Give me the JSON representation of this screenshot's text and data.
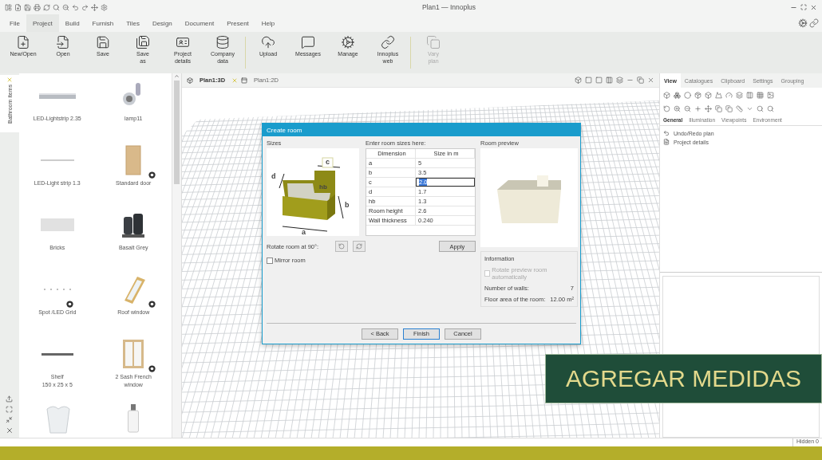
{
  "window": {
    "title": "Plan1 — Innoplus"
  },
  "menu": [
    {
      "label": "File",
      "selected": false
    },
    {
      "label": "Project",
      "selected": true
    },
    {
      "label": "Build",
      "selected": false
    },
    {
      "label": "Furnish",
      "selected": false
    },
    {
      "label": "Tiles",
      "selected": false
    },
    {
      "label": "Design",
      "selected": false
    },
    {
      "label": "Document",
      "selected": false
    },
    {
      "label": "Present",
      "selected": false
    },
    {
      "label": "Help",
      "selected": false
    }
  ],
  "ribbon": [
    {
      "buttons": [
        {
          "kind": "newopen",
          "label": "New/Open",
          "disabled": false
        },
        {
          "kind": "open",
          "label": "Open",
          "disabled": false
        },
        {
          "kind": "save",
          "label": "Save",
          "disabled": false
        },
        {
          "kind": "saveas",
          "label": "Save\nas",
          "disabled": false
        },
        {
          "kind": "details",
          "label": "Project\ndetails",
          "disabled": false
        },
        {
          "kind": "company",
          "label": "Company\ndata",
          "disabled": false
        }
      ]
    },
    {
      "buttons": [
        {
          "kind": "upload",
          "label": "Upload",
          "disabled": false
        },
        {
          "kind": "messages",
          "label": "Messages",
          "disabled": false
        },
        {
          "kind": "manage",
          "label": "Manage",
          "disabled": false
        },
        {
          "kind": "web",
          "label": "Innoplus\nweb",
          "disabled": false
        }
      ]
    },
    {
      "buttons": [
        {
          "kind": "vary",
          "label": "Vary\nplan",
          "disabled": true
        }
      ]
    }
  ],
  "catalog": {
    "tab": "Bathroom items",
    "items": [
      {
        "kind": "strip",
        "label": "LED-Lightstrip 2.35",
        "configurable": false
      },
      {
        "kind": "lamp",
        "label": "lamp11",
        "configurable": false
      },
      {
        "kind": "line",
        "label": "LED-Light strip 1.3",
        "configurable": false
      },
      {
        "kind": "door",
        "label": "Standard door",
        "configurable": true
      },
      {
        "kind": "tile",
        "label": "Bricks",
        "configurable": false
      },
      {
        "kind": "vases",
        "label": "Basalt Grey",
        "configurable": false
      },
      {
        "kind": "dots",
        "label": "Spot /LED Grid",
        "configurable": true
      },
      {
        "kind": "roofwindow",
        "label": "Roof window",
        "configurable": true
      },
      {
        "kind": "shelf",
        "label": "Shelf\n150 x 25 x 5",
        "configurable": false
      },
      {
        "kind": "frenchwindow",
        "label": "2 Sash French\nwindow",
        "configurable": true
      },
      {
        "kind": "vase",
        "configurable": false
      },
      {
        "kind": "bottle",
        "configurable": false
      }
    ]
  },
  "view_tabs": [
    {
      "label": "Plan1:3D",
      "kind": "perspective",
      "selected": true,
      "closable": true
    },
    {
      "label": "Plan1:2D",
      "kind": "plan",
      "selected": false,
      "closable": false
    }
  ],
  "dialog": {
    "title": "Create room",
    "sizes_label": "Sizes",
    "diagram_labels": {
      "a": "a",
      "b": "b",
      "c": "c",
      "d": "d",
      "hb": "hb"
    },
    "table_label": "Enter room sizes here:",
    "columns": [
      "Dimension",
      "Size in m"
    ],
    "rows": [
      {
        "dimension": "a",
        "size": "5",
        "selected": false
      },
      {
        "dimension": "b",
        "size": "3.5",
        "selected": false
      },
      {
        "dimension": "c",
        "size": "2.0",
        "selected": true
      },
      {
        "dimension": "d",
        "size": "1.7",
        "selected": false
      },
      {
        "dimension": "hb",
        "size": "1.3",
        "selected": false
      },
      {
        "dimension": "Room height",
        "size": "2.6",
        "selected": false
      },
      {
        "dimension": "Wall thickness",
        "size": "0.240",
        "selected": false
      }
    ],
    "preview_label": "Room preview",
    "rotate_label": "Rotate room at 90°:",
    "apply": "Apply",
    "mirror": {
      "label": "Mirror room",
      "checked": false
    },
    "information": {
      "title": "Information",
      "auto_rotate": {
        "label": "Rotate preview room automatically",
        "checked": false,
        "disabled": true
      },
      "walls_label": "Number of walls:",
      "walls": "7",
      "area_label": "Floor area of the room:",
      "area": "12.00 m²"
    },
    "buttons": [
      {
        "label": "< Back",
        "default": false
      },
      {
        "label": "Finish",
        "default": true
      },
      {
        "label": "Cancel",
        "default": false
      }
    ]
  },
  "right_panel": {
    "tabs": [
      {
        "label": "View",
        "selected": true
      },
      {
        "label": "Catalogues",
        "selected": false
      },
      {
        "label": "Clipboard",
        "selected": false
      },
      {
        "label": "Settings",
        "selected": false
      },
      {
        "label": "Grouping",
        "selected": false
      }
    ],
    "subtabs": [
      {
        "label": "General",
        "selected": true
      },
      {
        "label": "Illumination",
        "selected": false
      },
      {
        "label": "Viewpoints",
        "selected": false
      },
      {
        "label": "Environment",
        "selected": false
      }
    ],
    "items": [
      {
        "kind": "undo",
        "label": "Undo/Redo plan"
      },
      {
        "kind": "details",
        "label": "Project details"
      }
    ]
  },
  "status_bar": {
    "hidden": "Hidden 0"
  },
  "caption": "AGREGAR MEDIDAS"
}
